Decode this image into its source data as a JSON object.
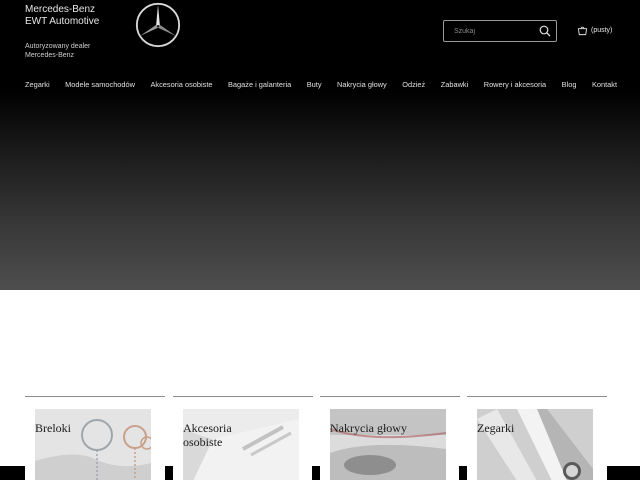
{
  "brand": {
    "line1": "Mercedes-Benz",
    "line2": "EWT Automotive",
    "sub1": "Autoryzowany dealer",
    "sub2": "Mercedes-Benz"
  },
  "search": {
    "placeholder": "Szukaj",
    "icon": "search-icon"
  },
  "cart": {
    "label": "(pusty)",
    "icon": "basket-icon"
  },
  "nav": [
    "Zegarki",
    "Modele samochodów",
    "Akcesoria osobiste",
    "Bagaże i galanteria",
    "Buty",
    "Nakrycia głowy",
    "Odzież",
    "Zabawki",
    "Rowery i akcesoria",
    "Blog",
    "Kontakt"
  ],
  "categories": [
    {
      "label": "Breloki"
    },
    {
      "label": "Akcesoria osobiste"
    },
    {
      "label": "Nakrycia głowy"
    },
    {
      "label": "Zegarki"
    }
  ],
  "colors": {
    "header_bg": "#000000",
    "hero_bottom": "#4e4e4e",
    "text_light": "#e8e8e8"
  }
}
